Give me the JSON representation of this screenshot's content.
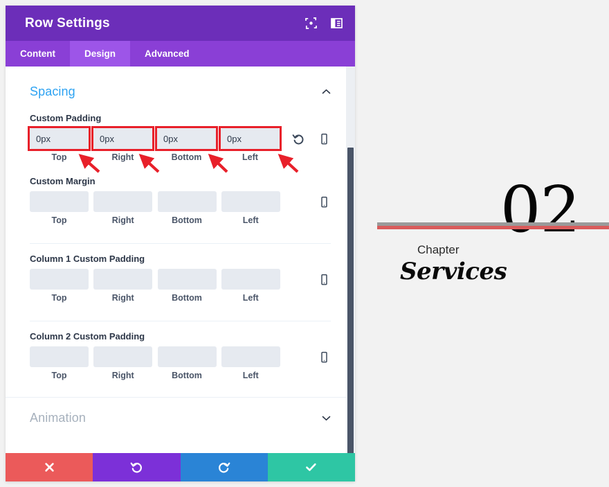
{
  "panel": {
    "title": "Row Settings",
    "header_icons": [
      {
        "name": "focus-target-icon",
        "glyph": "focus"
      },
      {
        "name": "layout-panel-icon",
        "glyph": "panel"
      }
    ],
    "tabs": [
      {
        "label": "Content",
        "active": false
      },
      {
        "label": "Design",
        "active": true
      },
      {
        "label": "Advanced",
        "active": false
      }
    ],
    "sections": [
      {
        "key": "spacing",
        "label": "Spacing",
        "expanded": true,
        "muted": false
      },
      {
        "key": "animation",
        "label": "Animation",
        "expanded": false,
        "muted": true
      }
    ],
    "spacing": {
      "groups": [
        {
          "label": "Custom Padding",
          "highlighted": true,
          "has_reset": true,
          "fields": [
            {
              "sub_label": "Top",
              "value": "0px"
            },
            {
              "sub_label": "Right",
              "value": "0px"
            },
            {
              "sub_label": "Bottom",
              "value": "0px"
            },
            {
              "sub_label": "Left",
              "value": "0px"
            }
          ]
        },
        {
          "label": "Custom Margin",
          "highlighted": false,
          "has_reset": false,
          "fields": [
            {
              "sub_label": "Top",
              "value": ""
            },
            {
              "sub_label": "Right",
              "value": ""
            },
            {
              "sub_label": "Bottom",
              "value": ""
            },
            {
              "sub_label": "Left",
              "value": ""
            }
          ]
        },
        {
          "label": "Column 1 Custom Padding",
          "highlighted": false,
          "has_reset": false,
          "fields": [
            {
              "sub_label": "Top",
              "value": ""
            },
            {
              "sub_label": "Right",
              "value": ""
            },
            {
              "sub_label": "Bottom",
              "value": ""
            },
            {
              "sub_label": "Left",
              "value": ""
            }
          ]
        },
        {
          "label": "Column 2 Custom Padding",
          "highlighted": false,
          "has_reset": false,
          "fields": [
            {
              "sub_label": "Top",
              "value": ""
            },
            {
              "sub_label": "Right",
              "value": ""
            },
            {
              "sub_label": "Bottom",
              "value": ""
            },
            {
              "sub_label": "Left",
              "value": ""
            }
          ]
        }
      ],
      "reset_icon": "reset-arrow-icon",
      "device_icon": "mobile-device-icon"
    },
    "footer_buttons": [
      {
        "name": "cancel-button",
        "glyph": "✖",
        "color": "#eb5a5a"
      },
      {
        "name": "undo-button",
        "glyph": "↺",
        "color": "#7c30d8"
      },
      {
        "name": "redo-button",
        "glyph": "↻",
        "color": "#2a84d6"
      },
      {
        "name": "save-button",
        "glyph": "✔",
        "color": "#2ec6a4"
      }
    ]
  },
  "preview": {
    "chapter_number": "02",
    "chapter_word": "Chapter",
    "chapter_title": "Services",
    "rule_gray_color": "#9a9a9a",
    "rule_red_color": "#d95b5b"
  },
  "annotations": {
    "box_color": "#e8202a",
    "arrow_count": 4,
    "arrow_color": "#e8202a"
  }
}
